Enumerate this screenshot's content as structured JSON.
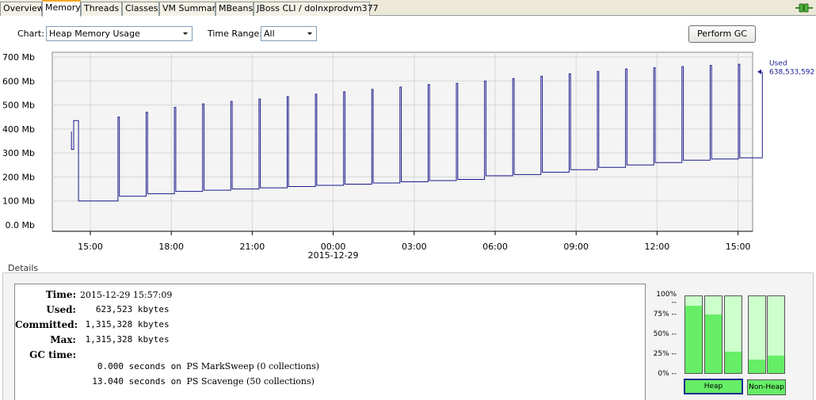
{
  "tabs": [
    {
      "label": "Overview",
      "active": false
    },
    {
      "label": "Memory",
      "active": true
    },
    {
      "label": "Threads",
      "active": false
    },
    {
      "label": "Classes",
      "active": false
    },
    {
      "label": "VM Summary",
      "active": false
    },
    {
      "label": "MBeans",
      "active": false
    },
    {
      "label": "JBoss CLI / dolnxprodvm377",
      "active": false
    }
  ],
  "toolbar": {
    "chart_label": "Chart:",
    "chart_value": "Heap Memory Usage",
    "range_label": "Time Range:",
    "range_value": "All",
    "gc_button": "Perform GC"
  },
  "chart_data": {
    "type": "line",
    "y_ticks": [
      "700 Mb",
      "600 Mb",
      "500 Mb",
      "400 Mb",
      "300 Mb",
      "200 Mb",
      "100 Mb",
      "0.0 Mb"
    ],
    "ylim": [
      0,
      700
    ],
    "x_ticks": [
      "15:00",
      "18:00",
      "21:00",
      "00:00",
      "03:00",
      "06:00",
      "09:00",
      "12:00",
      "15:00"
    ],
    "x_sub_label": "2015-12-29",
    "x_hours": [
      14.3,
      25.3
    ],
    "series": [
      {
        "name": "Used",
        "color": "#1a1a8c",
        "current": "638,533,592",
        "sawtooth": [
          [
            14.3,
            390,
            315
          ],
          [
            14.38,
            315,
            435
          ],
          [
            14.55,
            435,
            100
          ],
          [
            15.95,
            100,
            450
          ],
          [
            16.0,
            450,
            120
          ],
          [
            16.95,
            120,
            470
          ],
          [
            17.0,
            470,
            130
          ],
          [
            17.95,
            130,
            490
          ],
          [
            18.0,
            490,
            140
          ],
          [
            18.95,
            140,
            505
          ],
          [
            19.0,
            505,
            145
          ],
          [
            19.95,
            145,
            515
          ],
          [
            20.0,
            515,
            150
          ],
          [
            20.95,
            150,
            525
          ],
          [
            21.0,
            525,
            155
          ],
          [
            21.95,
            155,
            535
          ],
          [
            22.0,
            535,
            160
          ],
          [
            22.95,
            160,
            545
          ],
          [
            23.0,
            545,
            165
          ],
          [
            23.95,
            165,
            555
          ],
          [
            24.0,
            555,
            170
          ],
          [
            24.95,
            170,
            565
          ],
          [
            25.0,
            565,
            175
          ],
          [
            25.95,
            175,
            575
          ],
          [
            26.0,
            575,
            180
          ],
          [
            26.95,
            180,
            585
          ],
          [
            27.0,
            585,
            185
          ],
          [
            27.95,
            185,
            590
          ],
          [
            28.0,
            590,
            190
          ],
          [
            28.95,
            190,
            600
          ],
          [
            29.0,
            600,
            205
          ],
          [
            29.95,
            205,
            610
          ],
          [
            30.0,
            610,
            210
          ],
          [
            30.95,
            210,
            620
          ],
          [
            31.0,
            620,
            220
          ],
          [
            31.95,
            220,
            630
          ],
          [
            32.0,
            630,
            230
          ],
          [
            32.95,
            230,
            640
          ],
          [
            33.0,
            640,
            240
          ],
          [
            33.95,
            240,
            650
          ],
          [
            34.0,
            650,
            250
          ],
          [
            34.95,
            250,
            655
          ],
          [
            35.0,
            655,
            260
          ],
          [
            35.95,
            260,
            660
          ],
          [
            36.0,
            660,
            270
          ],
          [
            36.95,
            270,
            665
          ],
          [
            37.0,
            665,
            275
          ],
          [
            37.95,
            275,
            670
          ],
          [
            38.0,
            670,
            280
          ],
          [
            38.8,
            280,
            640
          ]
        ]
      }
    ],
    "legend_position": "right"
  },
  "details": {
    "title": "Details",
    "rows": [
      {
        "key": "Time:",
        "value": "2015-12-29 15:57:09",
        "style": "serif"
      },
      {
        "key": "Used:",
        "value": "   623,523 kbytes",
        "style": "mono"
      },
      {
        "key": "Committed:",
        "value": " 1,315,328 kbytes",
        "style": "mono"
      },
      {
        "key": "Max:",
        "value": " 1,315,328 kbytes",
        "style": "mono"
      },
      {
        "key": "GC time:",
        "value_mono": " 0.000 seconds on ",
        "value_serif": "PS MarkSweep (0 collections)"
      },
      {
        "key": "",
        "value_mono": "13.040 seconds on ",
        "value_serif": "PS Scavenge (50 collections)"
      }
    ]
  },
  "pools": {
    "pct_labels": [
      "100% --",
      "75% --",
      "50% --",
      "25% --",
      "0% --"
    ],
    "bars": [
      {
        "group": "Heap",
        "level": 0.88
      },
      {
        "group": "Heap",
        "level": 0.76
      },
      {
        "group": "Heap",
        "level": 0.28
      },
      {
        "group": "Non-Heap",
        "level": 0.18
      },
      {
        "group": "Non-Heap",
        "level": 0.23
      }
    ],
    "heap_label": "Heap",
    "nonheap_label": "Non-Heap"
  }
}
